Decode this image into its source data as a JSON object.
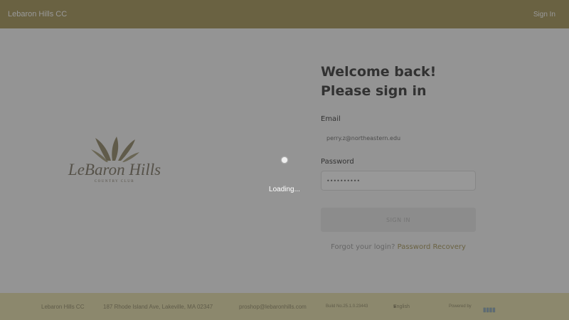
{
  "topbar": {
    "brand": "Lebaron Hills CC",
    "signin": "Sign In"
  },
  "logo": {
    "name": "LeBaron Hills",
    "sub": "COUNTRY CLUB"
  },
  "form": {
    "welcome_line1": "Welcome back!",
    "welcome_line2": "Please sign in",
    "email_label": "Email",
    "email_value": "perry.z@northeastern.edu",
    "password_label": "Password",
    "password_value": "••••••••••",
    "signin_button": "SIGN IN",
    "forgot_question": "Forgot your login?",
    "forgot_link": "Password Recovery"
  },
  "footer": {
    "club_name": "Lebaron Hills CC",
    "address": "187 Rhode Island Ave, Lakeville, MA 02347",
    "email": "proshop@lebaronhills.com",
    "build": "Build No.25.1.0.23443",
    "language": "English",
    "powered_by": "Powered by"
  },
  "loading": {
    "text": "Loading..."
  },
  "colors": {
    "topbar": "#a39353",
    "accent": "#a39353",
    "footer": "#e7dfa8"
  }
}
